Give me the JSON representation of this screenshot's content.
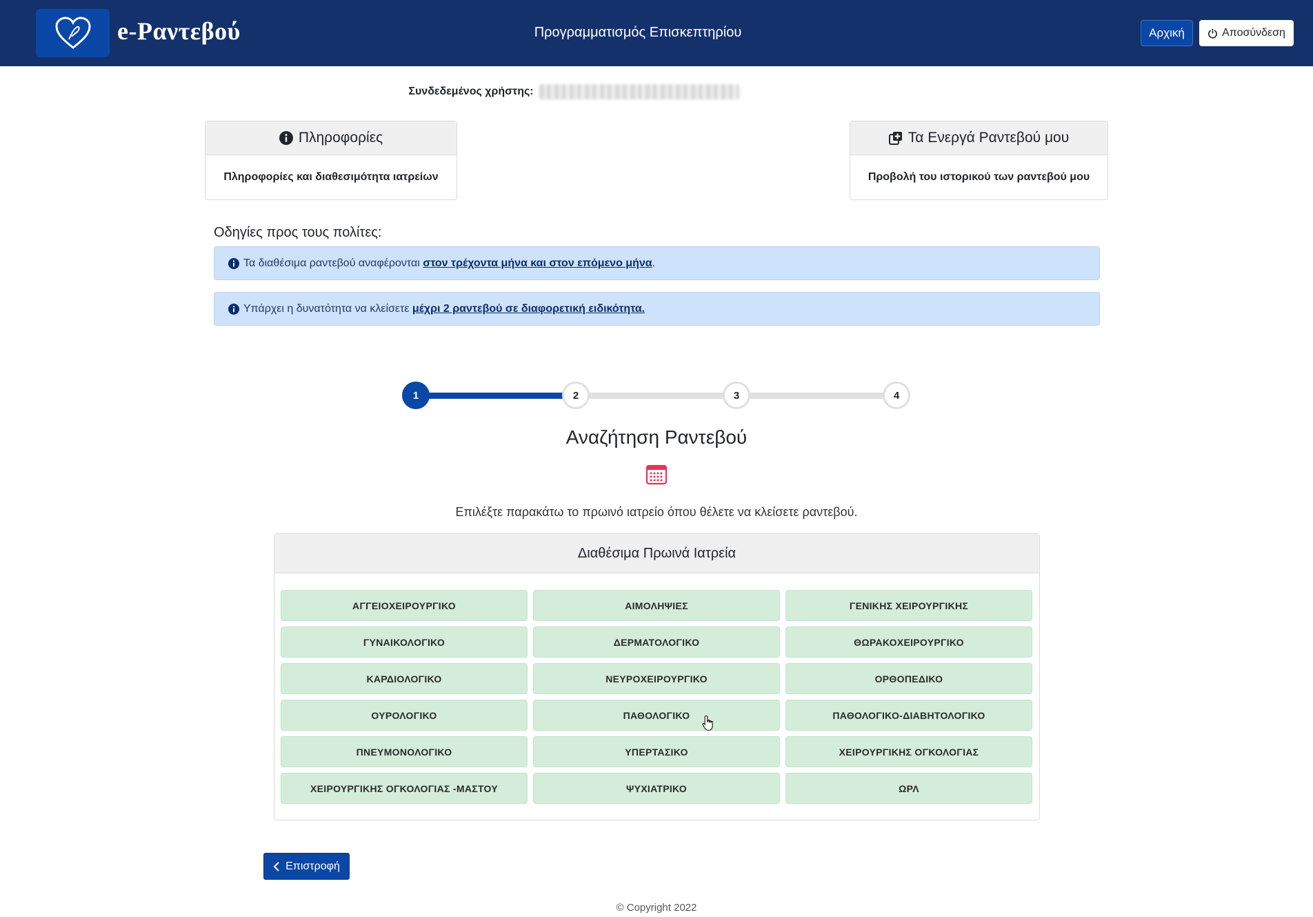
{
  "header": {
    "logo_text": "e-Ραντεβού",
    "title": "Προγραμματισμός Επισκεπτηρίου",
    "home_button": "Αρχική",
    "logout_button": "Αποσύνδεση"
  },
  "user": {
    "label": "Συνδεδεμένος χρήστης:"
  },
  "cards": {
    "info": {
      "title": "Πληροφορίες",
      "body": "Πληροφορίες και διαθεσιμότητα ιατρείων"
    },
    "appointments": {
      "title": "Τα Ενεργά Ραντεβού μου",
      "body": "Προβολή του ιστορικού των ραντεβού μου"
    }
  },
  "instructions": {
    "title": "Οδηγίες προς τους πολίτες:",
    "alert1_text": "Τα διαθέσιμα ραντεβού αναφέρονται ",
    "alert1_link": "στον τρέχοντα μήνα και στον επόμενο μήνα",
    "alert1_suffix": ".",
    "alert2_text": "Υπάρχει η δυνατότητα να κλείσετε ",
    "alert2_link": "μέχρι 2 ραντεβού σε διαφορετική ειδικότητα."
  },
  "stepper": {
    "steps": [
      "1",
      "2",
      "3",
      "4"
    ],
    "current_step": 1
  },
  "search": {
    "title": "Αναζήτηση Ραντεβού",
    "instruction": "Επιλέξτε παρακάτω το πρωινό ιατρείο όπου θέλετε να κλείσετε ραντεβού."
  },
  "clinics": {
    "title": "Διαθέσιμα Πρωινά Ιατρεία",
    "items": [
      "ΑΓΓΕΙΟΧΕΙΡΟΥΡΓΙΚΟ",
      "ΑΙΜΟΛΗΨΙΕΣ",
      "ΓΕΝΙΚΗΣ ΧΕΙΡΟΥΡΓΙΚΗΣ",
      "ΓΥΝΑΙΚΟΛΟΓΙΚΟ",
      "ΔΕΡΜΑΤΟΛΟΓΙΚΟ",
      "ΘΩΡΑΚΟΧΕΙΡΟΥΡΓΙΚΟ",
      "ΚΑΡΔΙΟΛΟΓΙΚΟ",
      "ΝΕΥΡΟΧΕΙΡΟΥΡΓΙΚΟ",
      "ΟΡΘΟΠΕΔΙΚΟ",
      "ΟΥΡΟΛΟΓΙΚΟ",
      "ΠΑΘΟΛΟΓΙΚΟ",
      "ΠΑΘΟΛΟΓΙΚΟ-ΔΙΑΒΗΤΟΛΟΓΙΚΟ",
      "ΠΝΕΥΜΟΝΟΛΟΓΙΚΟ",
      "ΥΠΕΡΤΑΣΙΚΟ",
      "ΧΕΙΡΟΥΡΓΙΚΗΣ ΟΓΚΟΛΟΓΙΑΣ",
      "ΧΕΙΡΟΥΡΓΙΚΗΣ ΟΓΚΟΛΟΓΙΑΣ -ΜΑΣΤΟΥ",
      "ΨΥΧΙΑΤΡΙΚΟ",
      "ΩΡΛ"
    ]
  },
  "back_button": "Επιστροφή",
  "footer": {
    "copyright": "© Copyright 2022"
  },
  "colors": {
    "header_bg": "#14316b",
    "primary": "#0b47a6",
    "alert_bg": "#cfe2fc",
    "clinic_bg": "#d4edda",
    "calendar_icon": "#e8315b"
  },
  "icons": {
    "logo": "heart-logo-icon",
    "logout": "power-icon",
    "info": "info-circle-icon",
    "appointments": "plus-copy-icon",
    "alert": "info-circle-icon",
    "calendar": "calendar-icon",
    "back": "chevron-left-icon"
  }
}
